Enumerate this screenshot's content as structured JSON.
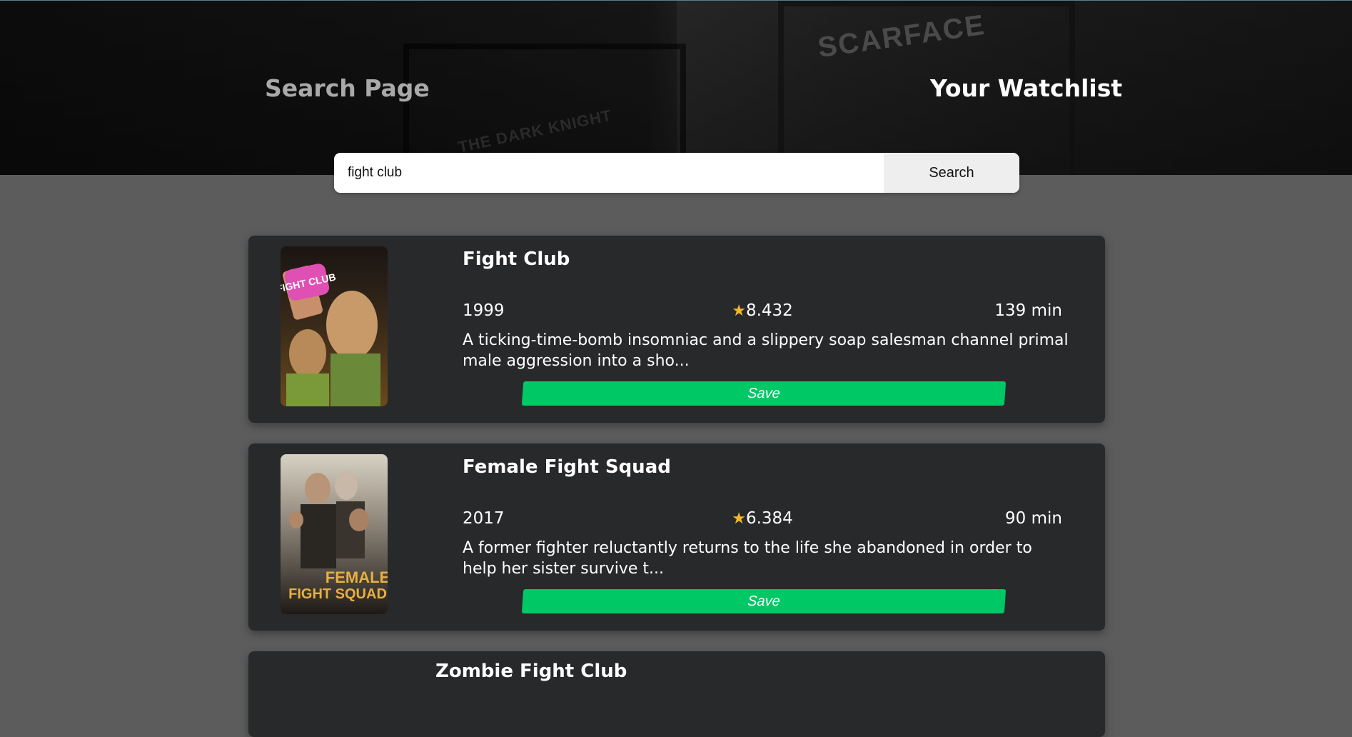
{
  "nav": {
    "search_label": "Search Page",
    "watchlist_label": "Your Watchlist"
  },
  "hero": {
    "poster_text_1": "SCARFACE",
    "poster_text_2": "THE DARK KNIGHT"
  },
  "search": {
    "value": "fight club",
    "button_label": "Search"
  },
  "results": [
    {
      "title": "Fight Club",
      "year": "1999",
      "rating": "8.432",
      "runtime": "139 min",
      "overview": "A ticking-time-bomb insomniac and a slippery soap salesman channel primal male aggression into a sho...",
      "save_label": "Save",
      "poster_text": "FIGHT CLUB"
    },
    {
      "title": "Female Fight Squad",
      "year": "2017",
      "rating": "6.384",
      "runtime": "90 min",
      "overview": "A former fighter reluctantly returns to the life she abandoned in order to help her sister survive t...",
      "save_label": "Save",
      "poster_text_1": "FEMALE",
      "poster_text_2": "FIGHT SQUAD"
    },
    {
      "title": "Zombie Fight Club"
    }
  ],
  "colors": {
    "save_button": "#00c864",
    "star": "#f5b731",
    "card_background": "#28292b",
    "page_background": "#5c5c5c"
  },
  "icons": {
    "rating": "star-icon"
  }
}
